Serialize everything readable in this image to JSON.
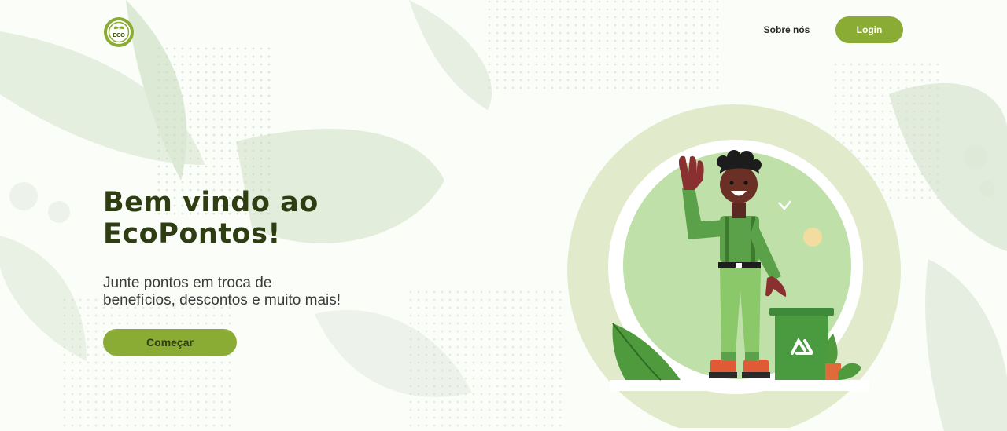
{
  "brand": {
    "logo_text": "ECO"
  },
  "nav": {
    "about_label": "Sobre nós",
    "login_label": "Login"
  },
  "hero": {
    "title_line1": "Bem vindo ao",
    "title_line2": "EcoPontos!",
    "subtitle_line1": "Junte pontos em troca de",
    "subtitle_line2": "benefícios, descontos e muito mais!",
    "cta_label": "Começar"
  },
  "colors": {
    "accent": "#8aab34",
    "title": "#2e3d12",
    "leaf": "#d8e8cf"
  }
}
